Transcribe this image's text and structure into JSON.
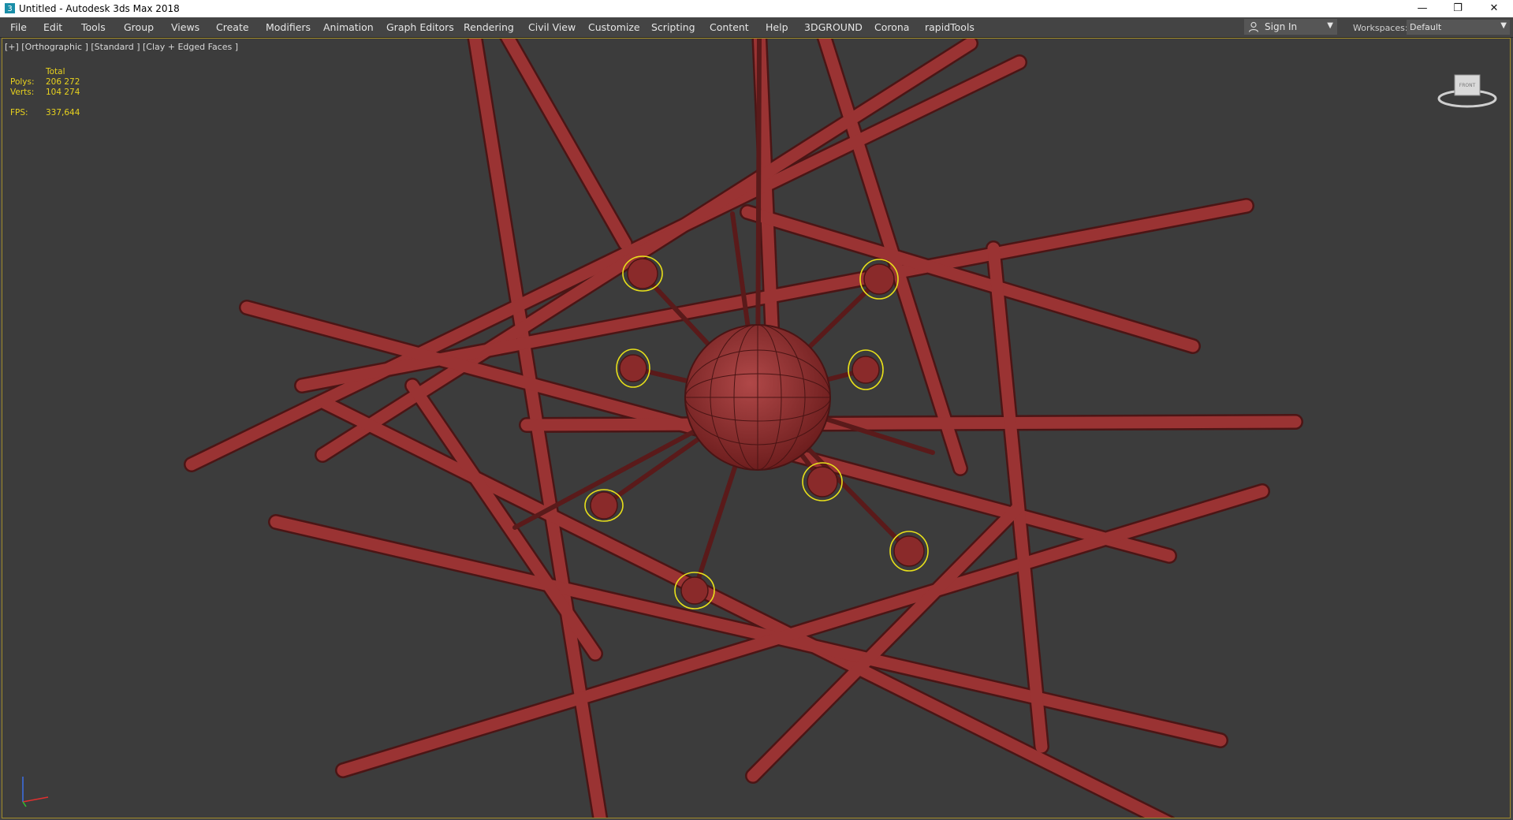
{
  "window": {
    "title": "Untitled - Autodesk 3ds Max 2018",
    "controls": [
      "minimize-icon",
      "restore-icon",
      "close-icon"
    ]
  },
  "menu": {
    "items": [
      "File",
      "Edit",
      "Tools",
      "Group",
      "Views",
      "Create",
      "Modifiers",
      "Animation",
      "Graph Editors",
      "Rendering",
      "Civil View",
      "Customize",
      "Scripting",
      "Content",
      "Help",
      "3DGROUND",
      "Corona",
      "rapidTools"
    ]
  },
  "signin": {
    "label": "Sign In"
  },
  "workspaces": {
    "label": "Workspaces:",
    "value": "Default"
  },
  "viewport": {
    "label": "[+] [Orthographic ] [Standard ] [Clay + Edged Faces ]",
    "stats": {
      "header": "Total",
      "polys_label": "Polys:",
      "polys": "206 272",
      "verts_label": "Verts:",
      "verts": "104 274",
      "fps_label": "FPS:",
      "fps": "337,644"
    },
    "viewcube_label": "FRONT"
  },
  "colors": {
    "viewport_bg": "#3c3c3c",
    "model": "#8a2a2a",
    "selection": "#e8e01a",
    "stats_text": "#e8d21e"
  }
}
